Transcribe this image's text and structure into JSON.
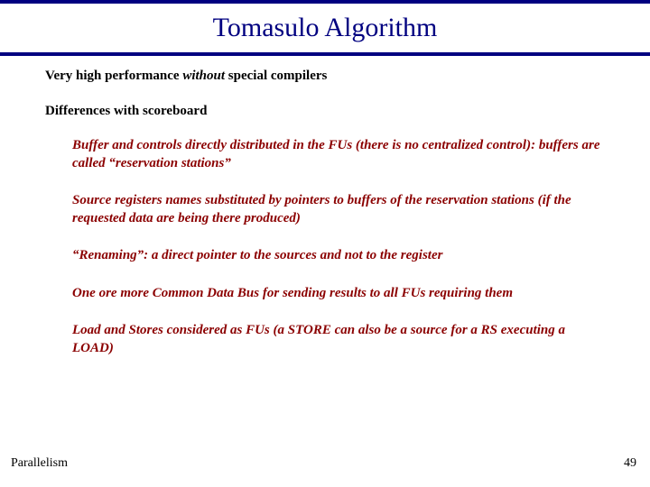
{
  "title": "Tomasulo Algorithm",
  "intro": {
    "prefix": "Very high performance ",
    "without": "without",
    "suffix": "  special compilers"
  },
  "subheading": "Differences with scoreboard",
  "bullets": [
    "Buffer and controls directly distributed in the FUs (there is no centralized control):  buffers are called  “reservation stations”",
    "Source registers names substituted by pointers to buffers of  the reservation stations (if  the requested data are being there produced)",
    "“Renaming”: a direct pointer to the sources and not to the register",
    "One ore more Common Data Bus for sending results to all FUs requiring them",
    "Load and Stores considered as FUs (a STORE can also be a source  for a RS executing a LOAD)"
  ],
  "footer": {
    "left": "Parallelism",
    "right": "49"
  }
}
